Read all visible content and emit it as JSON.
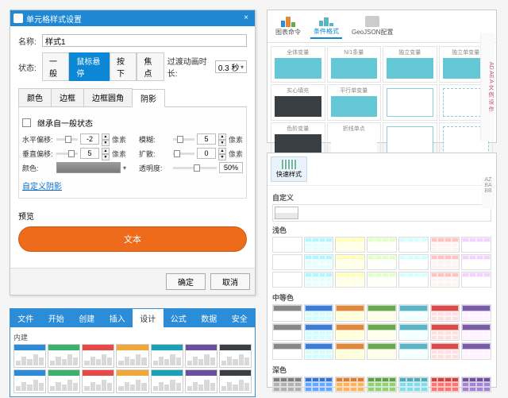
{
  "dialog": {
    "title": "单元格样式设置",
    "name_label": "名称:",
    "name_value": "样式1",
    "state_label": "状态:",
    "states": [
      "一般",
      "鼠标悬停",
      "按下",
      "焦点"
    ],
    "active_state": 1,
    "duration_label": "过渡动画时长:",
    "duration_value": "0.3 秒",
    "prop_tabs": [
      "颜色",
      "边框",
      "边框圆角",
      "阴影"
    ],
    "active_prop_tab": 3,
    "inherit_label": "继承自一般状态",
    "props": {
      "h_offset": {
        "label": "水平偏移:",
        "value": "-2",
        "unit": "像素"
      },
      "blur": {
        "label": "模糊:",
        "value": "5",
        "unit": "像素"
      },
      "v_offset": {
        "label": "垂直偏移:",
        "value": "5",
        "unit": "像素"
      },
      "spread": {
        "label": "扩散:",
        "value": "0",
        "unit": "像素"
      },
      "color": {
        "label": "颜色:"
      },
      "opacity": {
        "label": "透明度:",
        "value": "50%"
      }
    },
    "custom_link": "自定义阴影",
    "preview_label": "预览",
    "preview_text": "文本",
    "ok_btn": "确定",
    "cancel_btn": "取消"
  },
  "ribbon": {
    "tabs": [
      "文件",
      "开始",
      "创建",
      "插入",
      "设计",
      "公式",
      "数据",
      "安全"
    ],
    "active_tab": 4,
    "group_label": "内建",
    "theme_colors": [
      "#2b8cd8",
      "#38b26e",
      "#e84a4a",
      "#f2a73b",
      "#17a2b8",
      "#6b4fa0",
      "#3a3f44"
    ]
  },
  "chartcfg": {
    "tabs": [
      "图表命令",
      "条件格式",
      "GeoJSON配置"
    ],
    "active_tab": 1,
    "items": [
      "全体变量",
      "N/1条量",
      "独立变量",
      "独立单变量",
      "实心填充",
      "平行单变量",
      "",
      "",
      "色阶变量",
      "折线单点",
      "",
      ""
    ],
    "side_cols": "AD AE A 文 例 设 作"
  },
  "stylepick": {
    "button_label": "快速样式",
    "custom_label": "自定义",
    "light_label": "浅色",
    "medium_label": "中等色",
    "dark_label": "深色",
    "side_cols": "AZ BA BB",
    "palette_hues": [
      "#888888",
      "#3b7dd8",
      "#e0893a",
      "#6aa84f",
      "#5ab4c4",
      "#d94a4a",
      "#7a5ba6"
    ]
  }
}
